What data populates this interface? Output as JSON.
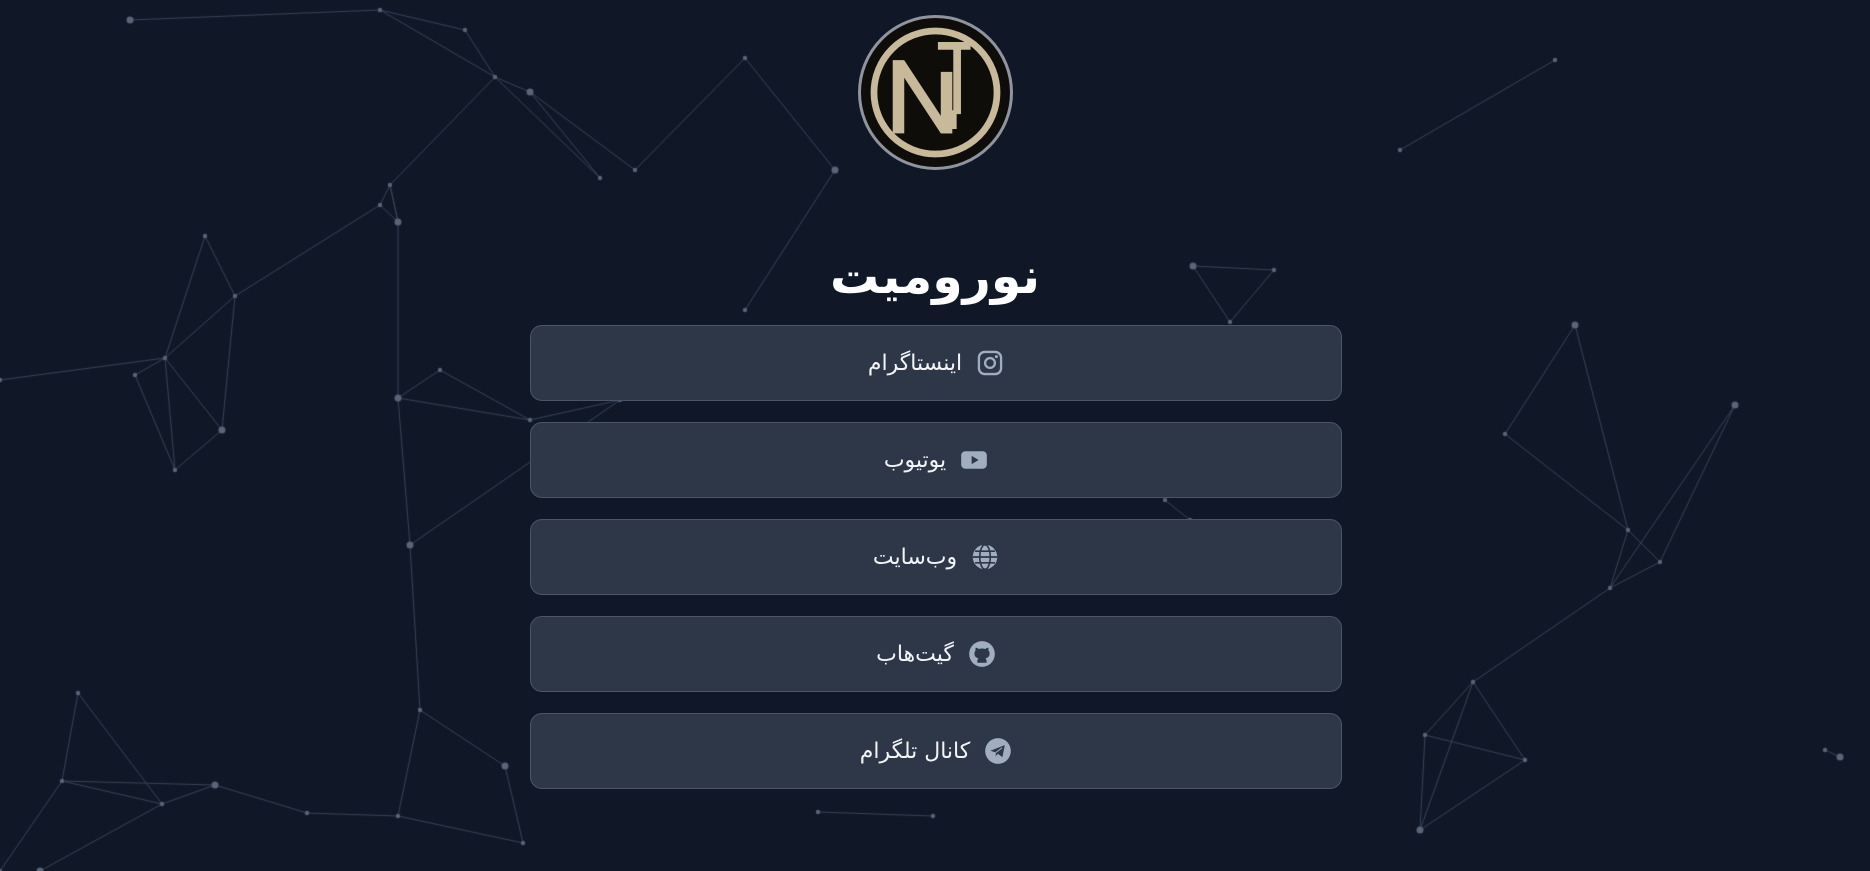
{
  "title": "نورومیت",
  "logo": {
    "name": "logo-nj-monogram"
  },
  "colors": {
    "background": "#101828",
    "button_bg": "#2d3748",
    "button_border": "#4a5568",
    "icon": "#a0aec0",
    "logo_gold": "#c8b99a",
    "network_lines": "#3a4458"
  },
  "links": [
    {
      "label": "اینستاگرام",
      "icon": "instagram-icon"
    },
    {
      "label": "یوتیوب",
      "icon": "youtube-icon"
    },
    {
      "label": "وب‌سایت",
      "icon": "globe-icon"
    },
    {
      "label": "گیت‌هاب",
      "icon": "github-icon"
    },
    {
      "label": "کانال تلگرام",
      "icon": "telegram-icon"
    }
  ]
}
